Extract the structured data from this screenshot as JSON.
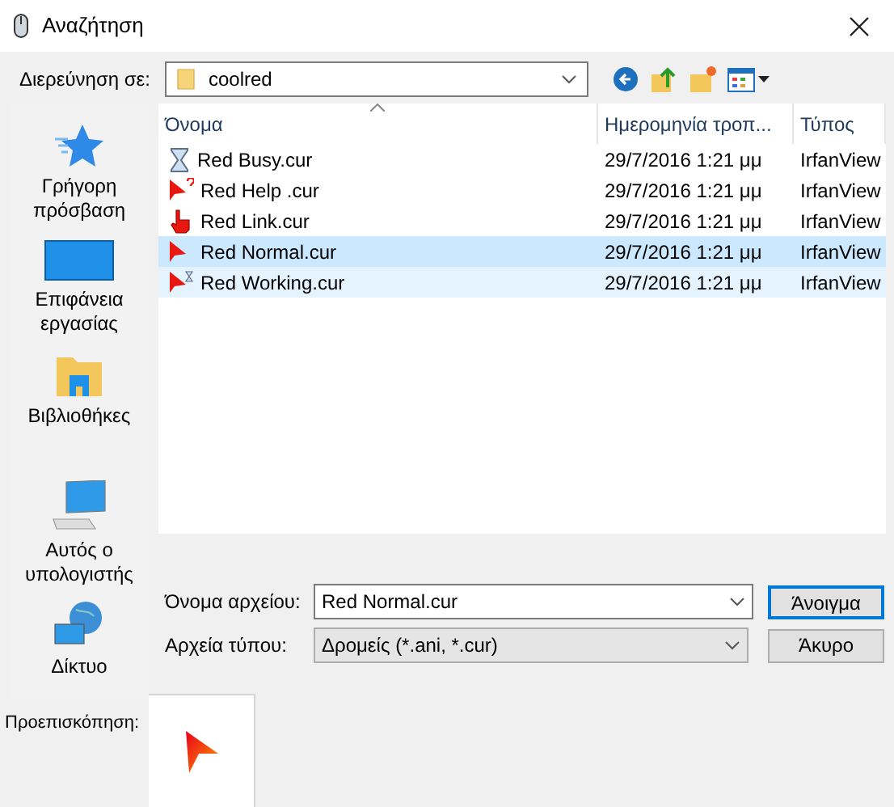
{
  "window": {
    "title": "Αναζήτηση"
  },
  "toolbar": {
    "label": "Διερεύνηση σε:",
    "location": "coolred"
  },
  "sidebar": {
    "items": [
      {
        "kind": "quick",
        "label": "Γρήγορη πρόσβαση"
      },
      {
        "kind": "desktop",
        "label": "Επιφάνεια εργασίας"
      },
      {
        "kind": "libraries",
        "label": "Βιβλιοθήκες"
      },
      {
        "kind": "computer",
        "label": "Αυτός ο υπολογιστής"
      },
      {
        "kind": "network",
        "label": "Δίκτυο"
      }
    ]
  },
  "table": {
    "columns": [
      "Όνομα",
      "Ημερομηνία τροπ...",
      "Τύπος"
    ],
    "rows": [
      {
        "kind": "busy",
        "name": "Red Busy.cur",
        "date": "29/7/2016 1:21 μμ",
        "type": "IrfanView",
        "selected": false,
        "hovered": false
      },
      {
        "kind": "help",
        "name": "Red Help .cur",
        "date": "29/7/2016 1:21 μμ",
        "type": "IrfanView",
        "selected": false,
        "hovered": false
      },
      {
        "kind": "link",
        "name": "Red Link.cur",
        "date": "29/7/2016 1:21 μμ",
        "type": "IrfanView",
        "selected": false,
        "hovered": false
      },
      {
        "kind": "arrow",
        "name": "Red Normal.cur",
        "date": "29/7/2016 1:21 μμ",
        "type": "IrfanView",
        "selected": true,
        "hovered": false
      },
      {
        "kind": "working",
        "name": "Red Working.cur",
        "date": "29/7/2016 1:21 μμ",
        "type": "IrfanView",
        "selected": false,
        "hovered": true
      }
    ]
  },
  "filename": {
    "label": "Όνομα αρχείου:",
    "value": "Red Normal.cur"
  },
  "filetype": {
    "label": "Αρχεία τύπου:",
    "value": "Δρομείς (*.ani, *.cur)"
  },
  "buttons": [
    "Άνοιγμα",
    "Άκυρο"
  ],
  "preview": {
    "label": "Προεπισκόπηση:"
  }
}
